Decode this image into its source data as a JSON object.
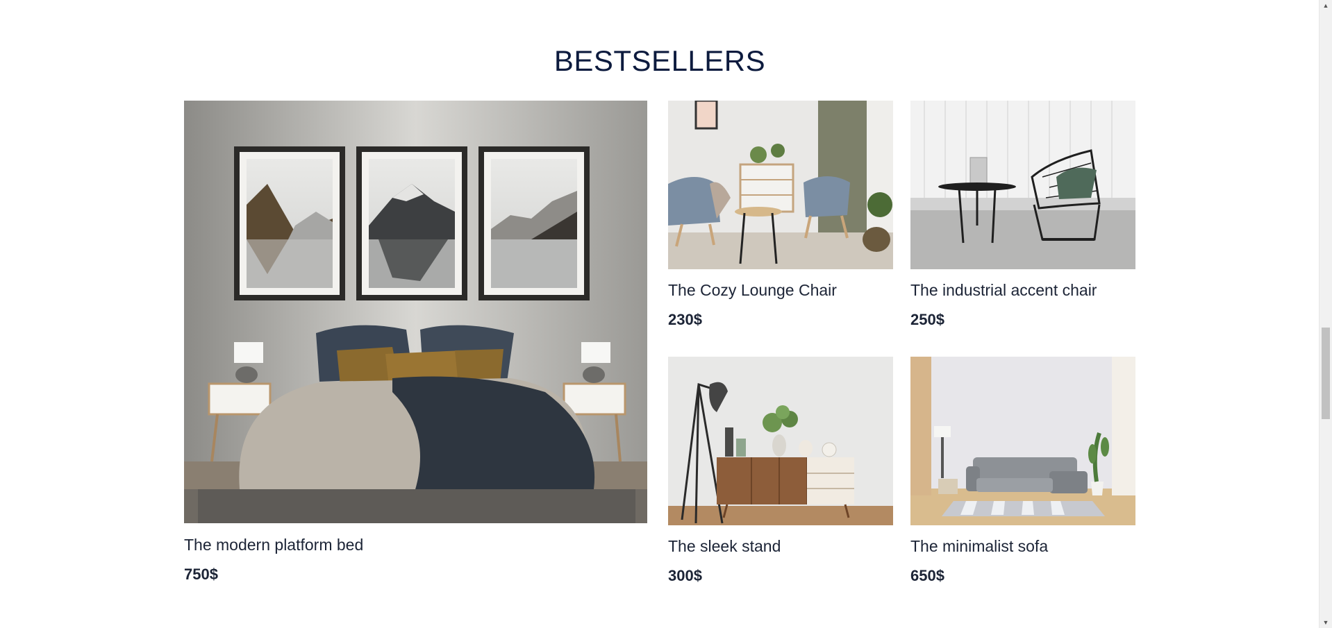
{
  "section": {
    "title": "BESTSELLERS"
  },
  "products": [
    {
      "name": "The modern platform bed",
      "price": "750$"
    },
    {
      "name": "The Cozy Lounge Chair",
      "price": "230$"
    },
    {
      "name": "The industrial accent chair",
      "price": "250$"
    },
    {
      "name": "The sleek stand",
      "price": "300$"
    },
    {
      "name": "The minimalist sofa",
      "price": "650$"
    }
  ],
  "scrollbar": {
    "up_icon": "chevron-up-icon",
    "down_icon": "chevron-down-icon"
  },
  "colors": {
    "heading": "#0d1b3e",
    "text": "#1c2436",
    "background": "#ffffff"
  }
}
